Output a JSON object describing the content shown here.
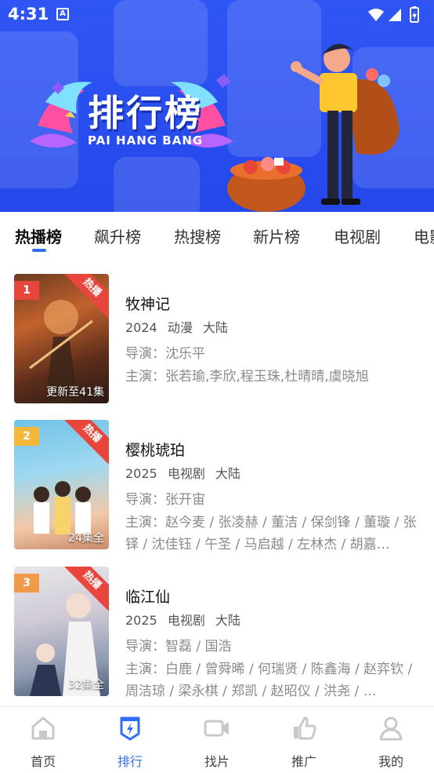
{
  "status_bar": {
    "time": "4:31",
    "app_badge": "A"
  },
  "banner": {
    "title": "排行榜",
    "subtitle": "PAI HANG BANG"
  },
  "tabs": [
    {
      "label": "热播榜",
      "active": true
    },
    {
      "label": "飙升榜",
      "active": false
    },
    {
      "label": "热搜榜",
      "active": false
    },
    {
      "label": "新片榜",
      "active": false
    },
    {
      "label": "电视剧",
      "active": false
    },
    {
      "label": "电影",
      "active": false
    }
  ],
  "list": [
    {
      "rank": "1",
      "rank_color": "#e8453c",
      "hot_badge": "热播",
      "episode": "更新至41集",
      "title": "牧神记",
      "year": "2024",
      "genre": "动漫",
      "region": "大陆",
      "director": "导演：沈乐平",
      "cast": "主演：张若瑜,李欣,程玉珠,杜晴晴,虞晓旭"
    },
    {
      "rank": "2",
      "rank_color": "#f4b73a",
      "hot_badge": "热播",
      "episode": "24集全",
      "title": "樱桃琥珀",
      "year": "2025",
      "genre": "电视剧",
      "region": "大陆",
      "director": "导演：张开宙",
      "cast": "主演：赵今麦 / 张凌赫 / 董洁 / 保剑锋 / 董璇 / 张铎 / 沈佳钰 / 午圣 / 马启越 / 左林杰 / 胡嘉…"
    },
    {
      "rank": "3",
      "rank_color": "#f09a4a",
      "hot_badge": "热播",
      "episode": "32集全",
      "title": "临江仙",
      "year": "2025",
      "genre": "电视剧",
      "region": "大陆",
      "director": "导演：智磊 / 国浩",
      "cast": "主演：白鹿 / 曾舜晞 / 何瑞贤 / 陈鑫海 / 赵弈钦 / 周洁琼 / 梁永棋 / 郑凯 / 赵昭仪 / 洪尧 / …"
    }
  ],
  "bottom_nav": [
    {
      "label": "首页",
      "icon": "home-icon",
      "active": false
    },
    {
      "label": "排行",
      "icon": "ranking-icon",
      "active": true
    },
    {
      "label": "找片",
      "icon": "video-camera-icon",
      "active": false
    },
    {
      "label": "推广",
      "icon": "thumbs-up-icon",
      "active": false
    },
    {
      "label": "我的",
      "icon": "user-icon",
      "active": false
    }
  ],
  "colors": {
    "accent": "#2f6df6",
    "banner": "#2a4ff0",
    "hot": "#e8453c"
  }
}
